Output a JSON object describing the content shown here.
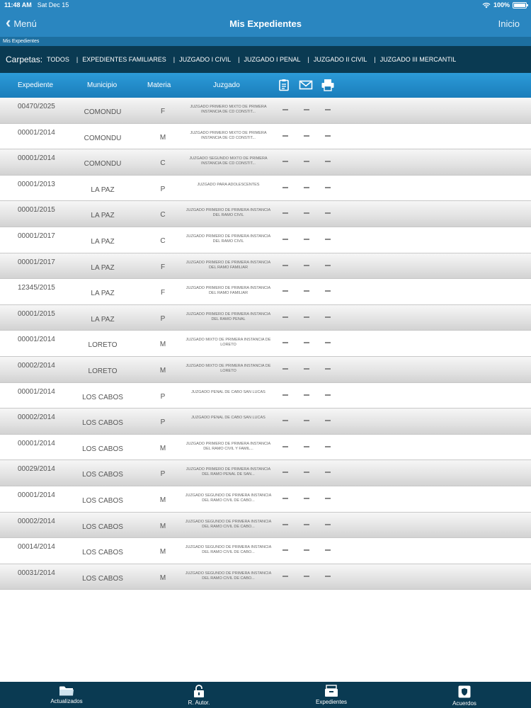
{
  "status": {
    "time": "11:48 AM",
    "date": "Sat Dec 15",
    "battery": "100%"
  },
  "nav": {
    "back": "Menú",
    "title": "Mis Expedientes",
    "home": "Inicio"
  },
  "breadcrumb": "Mis Expedientes",
  "folders": {
    "label": "Carpetas:",
    "tabs": [
      "TODOS",
      "EXPEDIENTES FAMILIARES",
      "JUZGADO I CIVIL",
      "JUZGADO I PENAL",
      "JUZGADO II CIVIL",
      "JUZGADO III MERCANTIL"
    ]
  },
  "columns": {
    "expediente": "Expediente",
    "municipio": "Municipio",
    "materia": "Materia",
    "juzgado": "Juzgado"
  },
  "rows": [
    {
      "exp": "00470/2025",
      "mun": "COMONDU",
      "mat": "F",
      "juz": "JUZGADO PRIMERO MIXTO DE PRIMERA INSTANCIA DE CD CONSTIT..."
    },
    {
      "exp": "00001/2014",
      "mun": "COMONDU",
      "mat": "M",
      "juz": "JUZGADO PRIMERO MIXTO DE PRIMERA INSTANCIA DE CD CONSTIT..."
    },
    {
      "exp": "00001/2014",
      "mun": "COMONDU",
      "mat": "C",
      "juz": "JUZGADO SEGUNDO MIXTO DE PRIMERA INSTANCIA DE CD CONSTIT..."
    },
    {
      "exp": "00001/2013",
      "mun": "LA PAZ",
      "mat": "P",
      "juz": "JUZGADO PARA ADOLESCENTES"
    },
    {
      "exp": "00001/2015",
      "mun": "LA PAZ",
      "mat": "C",
      "juz": "JUZGADO PRIMERO DE PRIMERA INSTANCIA DEL RAMO CIVIL"
    },
    {
      "exp": "00001/2017",
      "mun": "LA PAZ",
      "mat": "C",
      "juz": "JUZGADO PRIMERO DE PRIMERA INSTANCIA DEL RAMO CIVIL"
    },
    {
      "exp": "00001/2017",
      "mun": "LA PAZ",
      "mat": "F",
      "juz": "JUZGADO PRIMERO DE PRIMERA INSTANCIA DEL RAMO FAMILIAR"
    },
    {
      "exp": "12345/2015",
      "mun": "LA PAZ",
      "mat": "F",
      "juz": "JUZGADO PRIMERO DE PRIMERA INSTANCIA DEL RAMO FAMILIAR"
    },
    {
      "exp": "00001/2015",
      "mun": "LA PAZ",
      "mat": "P",
      "juz": "JUZGADO PRIMERO DE PRIMERA INSTANCIA DEL RAMO PENAL"
    },
    {
      "exp": "00001/2014",
      "mun": "LORETO",
      "mat": "M",
      "juz": "JUZGADO MIXTO DE PRIMERA INSTANCIA DE LORETO"
    },
    {
      "exp": "00002/2014",
      "mun": "LORETO",
      "mat": "M",
      "juz": "JUZGADO MIXTO DE PRIMERA INSTANCIA DE LORETO"
    },
    {
      "exp": "00001/2014",
      "mun": "LOS CABOS",
      "mat": "P",
      "juz": "JUZGADO PENAL DE CABO SAN LUCAS"
    },
    {
      "exp": "00002/2014",
      "mun": "LOS CABOS",
      "mat": "P",
      "juz": "JUZGADO PENAL DE CABO SAN LUCAS"
    },
    {
      "exp": "00001/2014",
      "mun": "LOS CABOS",
      "mat": "M",
      "juz": "JUZGADO PRIMERO DE PRIMERA INSTANCIA DEL RAMO CIVIL Y FAMIL..."
    },
    {
      "exp": "00029/2014",
      "mun": "LOS CABOS",
      "mat": "P",
      "juz": "JUZGADO PRIMERO DE PRIMERA INSTANCIA DEL RAMO PENAL DE SAN..."
    },
    {
      "exp": "00001/2014",
      "mun": "LOS CABOS",
      "mat": "M",
      "juz": "JUZGADO SEGUNDO DE PRIMERA INSTANCIA DEL RAMO CIVIL DE CABO..."
    },
    {
      "exp": "00002/2014",
      "mun": "LOS CABOS",
      "mat": "M",
      "juz": "JUZGADO SEGUNDO DE PRIMERA INSTANCIA DEL RAMO CIVIL DE CABO..."
    },
    {
      "exp": "00014/2014",
      "mun": "LOS CABOS",
      "mat": "M",
      "juz": "JUZGADO SEGUNDO DE PRIMERA INSTANCIA DEL RAMO CIVIL DE CABO..."
    },
    {
      "exp": "00031/2014",
      "mun": "LOS CABOS",
      "mat": "M",
      "juz": "JUZGADO SEGUNDO DE PRIMERA INSTANCIA DEL RAMO CIVIL DE CABO..."
    }
  ],
  "tabbar": [
    {
      "label": "Actualizados",
      "icon": "folder-icon"
    },
    {
      "label": "R. Autor.",
      "icon": "lock-icon"
    },
    {
      "label": "Expedientes",
      "icon": "file-box-icon"
    },
    {
      "label": "Acuerdos",
      "icon": "badge-icon"
    }
  ]
}
